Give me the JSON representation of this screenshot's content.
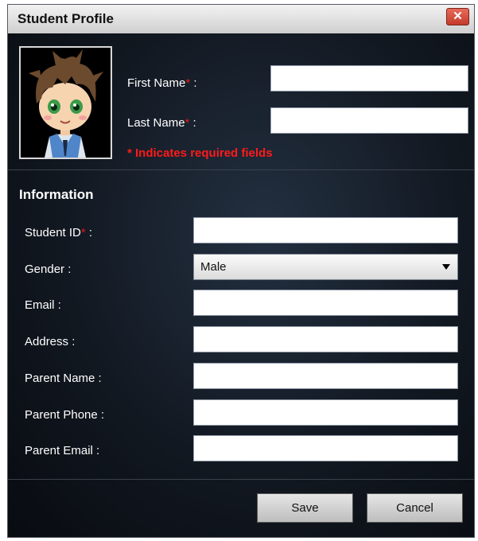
{
  "window": {
    "title": "Student Profile",
    "close_glyph": "✕"
  },
  "profile": {
    "first_name": {
      "label": "First Name",
      "required_mark": "*",
      "suffix": " :",
      "value": ""
    },
    "last_name": {
      "label": "Last Name",
      "required_mark": "*",
      "suffix": " :",
      "value": ""
    },
    "required_note": "* Indicates required fields"
  },
  "information": {
    "title": "Information",
    "student_id": {
      "label": "Student ID",
      "required_mark": "*",
      "suffix": " :",
      "value": ""
    },
    "gender": {
      "label": "Gender :",
      "value": "Male"
    },
    "email": {
      "label": "Email :",
      "value": ""
    },
    "address": {
      "label": "Address :",
      "value": ""
    },
    "parent_name": {
      "label": "Parent Name :",
      "value": ""
    },
    "parent_phone": {
      "label": "Parent Phone :",
      "value": ""
    },
    "parent_email": {
      "label": "Parent Email :",
      "value": ""
    }
  },
  "actions": {
    "save": "Save",
    "cancel": "Cancel"
  },
  "colors": {
    "required": "#e11b1b",
    "note": "#ff1a1a",
    "background": "#0b0f16"
  },
  "icons": {
    "close": "close-icon",
    "avatar": "student-avatar",
    "dropdown": "chevron-down-icon"
  }
}
